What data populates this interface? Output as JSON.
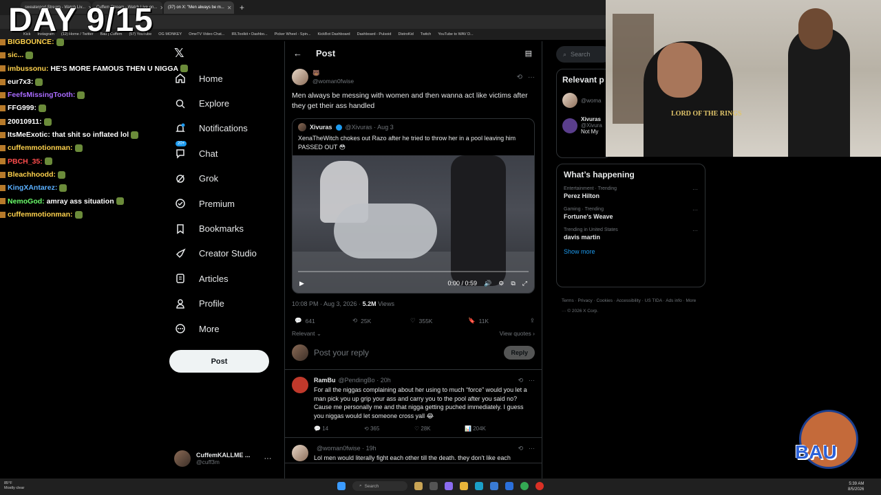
{
  "browser": {
    "tabs": [
      {
        "label": "sweatergod Stream - Watch Liv...",
        "active": false
      },
      {
        "label": "Cuffem Stream - Watch Live on...",
        "active": false
      },
      {
        "label": "(37) on X: \"Men always be m...",
        "active": true
      }
    ],
    "bookmarks": [
      "Kick",
      "Instagram",
      "(12) Home / Twitter",
      "Bau | Cuffem",
      "(57) YouTube",
      "OG MONKEY",
      "OmeTV Video Chat...",
      "IRLToolkit • Dashbo...",
      "Picker Wheel - Spin...",
      "KickBot Dashboard",
      "Dashboard - Pulsoid",
      "DistroKid",
      "Twitch",
      "YouTube to WAV D..."
    ]
  },
  "overlay": {
    "day_banner": "DAY 9/15",
    "chat": [
      {
        "user": "BIGBOUNCE:",
        "msg": "",
        "color": "#ffd24d"
      },
      {
        "user": "sic...",
        "msg": "",
        "color": "#ffd24d"
      },
      {
        "user": "imbussonu:",
        "msg": "HE'S MORE FAMOUS THEN U NIGGA",
        "color": "#ffd24d"
      },
      {
        "user": "eur7x3:",
        "msg": "",
        "color": "#ffffff"
      },
      {
        "user": "FeefsMissingTooth:",
        "msg": "",
        "color": "#a96bff"
      },
      {
        "user": "FFG999:",
        "msg": "",
        "color": "#ffffff"
      },
      {
        "user": "20010911:",
        "msg": "",
        "color": "#ffffff"
      },
      {
        "user": "ItsMeExotic:",
        "msg": "that shit so inflated lol",
        "color": "#ffffff"
      },
      {
        "user": "cuffemmotionman:",
        "msg": "",
        "color": "#ffd24d"
      },
      {
        "user": "PBCH_35:",
        "msg": "",
        "color": "#ff4d4d"
      },
      {
        "user": "Bleachhoodd:",
        "msg": "",
        "color": "#ffd24d"
      },
      {
        "user": "KingXAntarez:",
        "msg": "",
        "color": "#5ab0ff"
      },
      {
        "user": "NemoGod:",
        "msg": "amray ass situation",
        "color": "#6bff6b"
      },
      {
        "user": "cuffemmotionman:",
        "msg": "",
        "color": "#ffd24d"
      }
    ]
  },
  "nav": {
    "items": [
      {
        "label": "Home",
        "icon": "home-icon"
      },
      {
        "label": "Explore",
        "icon": "search-icon"
      },
      {
        "label": "Notifications",
        "icon": "bell-icon"
      },
      {
        "label": "Chat",
        "icon": "chat-icon",
        "badge": "20+"
      },
      {
        "label": "Grok",
        "icon": "grok-icon"
      },
      {
        "label": "Premium",
        "icon": "premium-icon"
      },
      {
        "label": "Bookmarks",
        "icon": "bookmark-icon"
      },
      {
        "label": "Creator Studio",
        "icon": "rocket-icon"
      },
      {
        "label": "Articles",
        "icon": "article-icon"
      },
      {
        "label": "Profile",
        "icon": "person-icon"
      },
      {
        "label": "More",
        "icon": "more-circle-icon"
      }
    ],
    "post_button": "Post",
    "account": {
      "name": "CuffemKALLME ...",
      "handle": "@cuff3m"
    }
  },
  "post": {
    "header_title": "Post",
    "author_handle": "@woman0fwise",
    "text": "Men always be messing with women and then wanna act like victims after they get their ass handled",
    "quote": {
      "name": "Xivuras",
      "meta": "@Xivuras · Aug 3",
      "text": "XenaTheWitch chokes out Razo after he tried to throw her in a pool leaving him PASSED OUT 😳"
    },
    "video_time": "0:00 / 0:59",
    "timestamp": "10:08 PM · Aug 3, 2026 · ",
    "views": "5.2M",
    "views_label": " Views",
    "stats": {
      "replies": "641",
      "reposts": "25K",
      "likes": "355K",
      "bookmarks": "11K"
    },
    "sort_label": "Relevant ⌄",
    "view_quotes": "View quotes ›",
    "reply_placeholder": "Post your reply",
    "reply_button": "Reply"
  },
  "replies": [
    {
      "name": "RamBu",
      "meta": "@PendingBo · 20h",
      "text": "For all the niggas complaining about her using to much “force” would you let a man pick you up grip your ass and carry you to the pool after you said no? Cause me personally me and that nigga getting puched immediately. I guess you niggas would let someone cross yall 😂",
      "stats": {
        "replies": "14",
        "reposts": "365",
        "likes": "28K",
        "views": "204K"
      }
    },
    {
      "name": "",
      "meta": "@woman0fwise · 19h",
      "text": "Lol men would literally fight each other till the death. they don't like each",
      "stats": {
        "replies": "",
        "reposts": "",
        "likes": "",
        "views": ""
      }
    }
  ],
  "sidebar": {
    "search_placeholder": "Search",
    "relevant_title": "Relevant p",
    "relevant_users": [
      {
        "name": "",
        "handle": "@woma"
      },
      {
        "name": "Xivuras",
        "handle": "@Xivura",
        "bio": "Not My"
      }
    ],
    "happening_title": "What’s happening",
    "trends": [
      {
        "category": "Entertainment · Trending",
        "name": "Perez Hilton"
      },
      {
        "category": "Gaming · Trending",
        "name": "Fortune's Weave"
      },
      {
        "category": "Trending in United States",
        "name": "davis martin"
      }
    ],
    "show_more": "Show more",
    "footer": "Terms · Privacy · Cookies · Accessibility · US TIDA · Ads info · More ··· © 2026 X Corp."
  },
  "webcam": {
    "shirt_text": "LORD OF THE RINGS"
  },
  "logo": {
    "text": "BAU"
  },
  "taskbar": {
    "weather_temp": "85°F",
    "weather_desc": "Mostly clear",
    "search": "Search",
    "time": "5:39 AM",
    "date": "8/5/2026"
  },
  "colors": {
    "accent": "#1d9bf0",
    "bg": "#000000",
    "border": "#2f3336",
    "muted": "#71767b"
  }
}
